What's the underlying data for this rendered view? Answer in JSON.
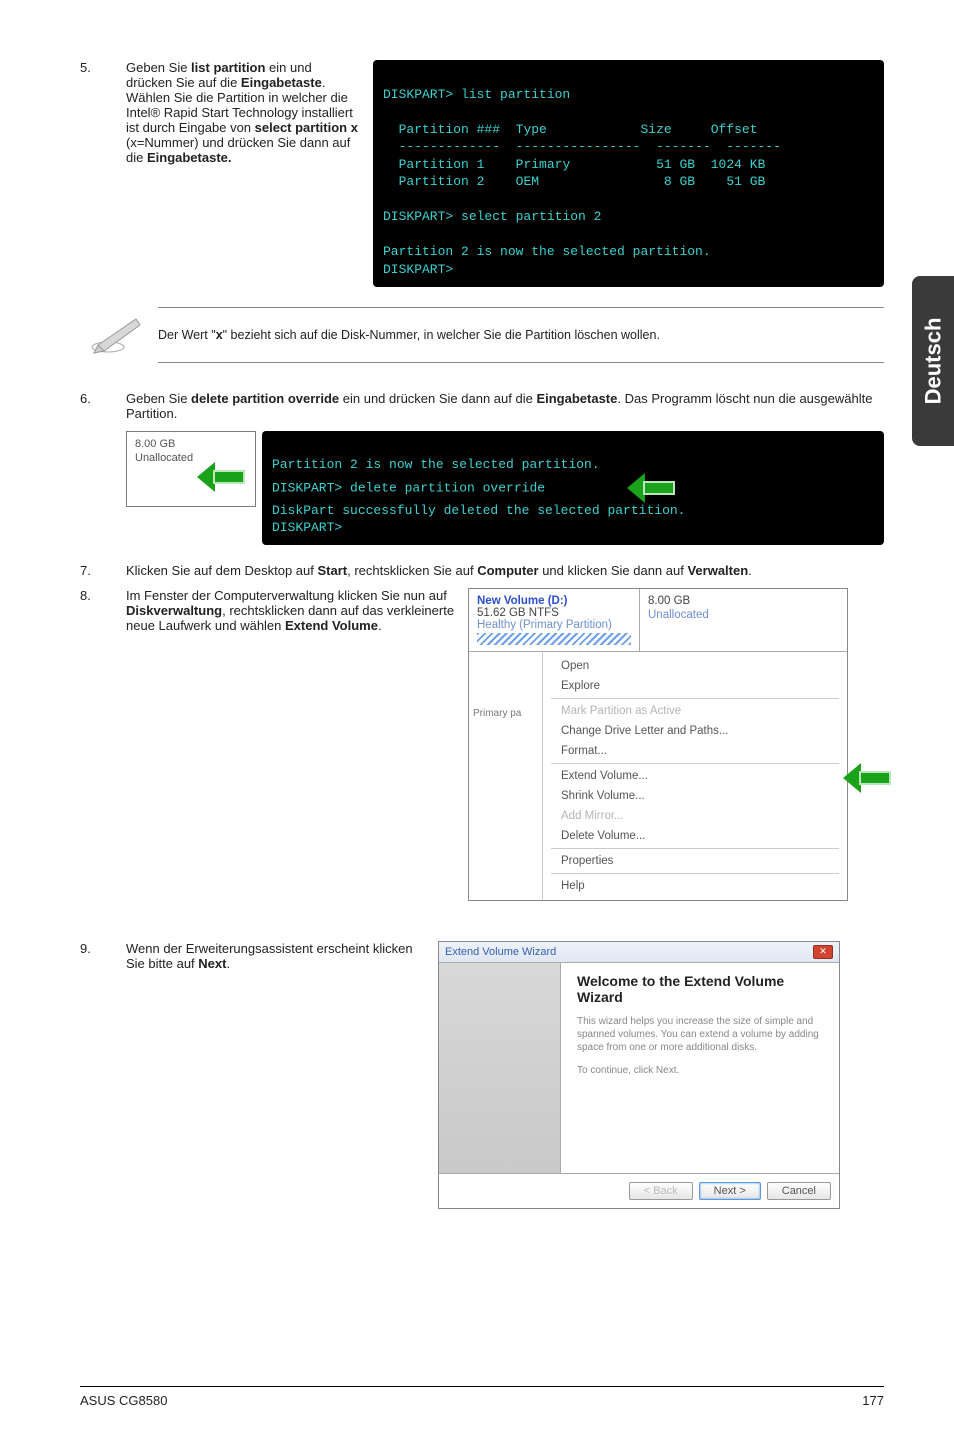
{
  "side_tab": "Deutsch",
  "steps": {
    "s5": {
      "num": "5.",
      "text_parts": [
        "Geben Sie ",
        "list partition",
        " ein und drücken Sie auf die ",
        "Eingabetaste",
        ". Wählen Sie die Partition in welcher die Intel® Rapid Start Technology installiert ist durch Eingabe von ",
        "select partition x",
        " (x=Nummer) und drücken Sie dann auf die ",
        "Eingabetaste."
      ]
    },
    "s6": {
      "num": "6.",
      "text_parts": [
        "Geben Sie ",
        "delete partition override",
        " ein und drücken Sie dann auf die ",
        "Eingabetaste",
        ". Das Programm löscht nun die ausgewählte Partition."
      ]
    },
    "s7": {
      "num": "7.",
      "text_parts": [
        "Klicken Sie auf dem Desktop auf ",
        "Start",
        ", rechtsklicken Sie auf ",
        "Computer",
        " und klicken Sie dann auf ",
        "Verwalten",
        "."
      ]
    },
    "s8": {
      "num": "8.",
      "text_parts": [
        "Im Fenster der Computerverwaltung klicken Sie nun auf ",
        "Diskverwaltung",
        ", rechtsklicken dann auf das verkleinerte neue Laufwerk und wählen ",
        "Extend Volume",
        "."
      ]
    },
    "s9": {
      "num": "9.",
      "text_parts": [
        "Wenn der Erweiterungsassistent erscheint klicken Sie bitte auf ",
        "Next",
        "."
      ]
    }
  },
  "note": "Der Wert \"x\" bezieht sich auf die Disk-Nummer, in welcher Sie die Partition löschen wollen.",
  "terminal5": {
    "line1": "DISKPART> list partition",
    "hdr": {
      "c1": "Partition ###",
      "c2": "Type",
      "c3": "Size",
      "c4": "Offset"
    },
    "row1": {
      "c1": "Partition 1",
      "c2": "Primary",
      "c3": "51 GB",
      "c4": "1024 KB"
    },
    "row2": {
      "c1": "Partition 2",
      "c2": "OEM",
      "c3": "8 GB",
      "c4": "51 GB"
    },
    "sel": "DISKPART> select partition 2",
    "res": "Partition 2 is now the selected partition.",
    "prompt": "DISKPART>"
  },
  "unalloc": {
    "size": "8.00 GB",
    "label": "Unallocated"
  },
  "terminal6": {
    "l1": "Partition 2 is now the selected partition.",
    "l2": "DISKPART> delete partition override",
    "l3": "DiskPart successfully deleted the selected partition.",
    "l4": "DISKPART>"
  },
  "vol_header": {
    "title": "New Volume (D:)",
    "size": "51.62 GB NTFS",
    "status": "Healthy (Primary Partition)",
    "r_size": "8.00 GB",
    "r_label": "Unallocated"
  },
  "menu_left": "Primary pa",
  "menu": {
    "open": "Open",
    "explore": "Explore",
    "mark": "Mark Partition as Active",
    "change": "Change Drive Letter and Paths...",
    "format": "Format...",
    "extend": "Extend Volume...",
    "shrink": "Shrink Volume...",
    "addmirror": "Add Mirror...",
    "delete": "Delete Volume...",
    "props": "Properties",
    "help": "Help"
  },
  "wizard": {
    "titlebar": "Extend Volume Wizard",
    "heading": "Welcome to the Extend Volume Wizard",
    "p1": "This wizard helps you increase the size of simple and spanned volumes. You can extend a volume by adding space from one or more additional disks.",
    "p2": "To continue, click Next.",
    "back": "< Back",
    "next": "Next >",
    "cancel": "Cancel"
  },
  "footer": {
    "left": "ASUS CG8580",
    "right": "177"
  }
}
